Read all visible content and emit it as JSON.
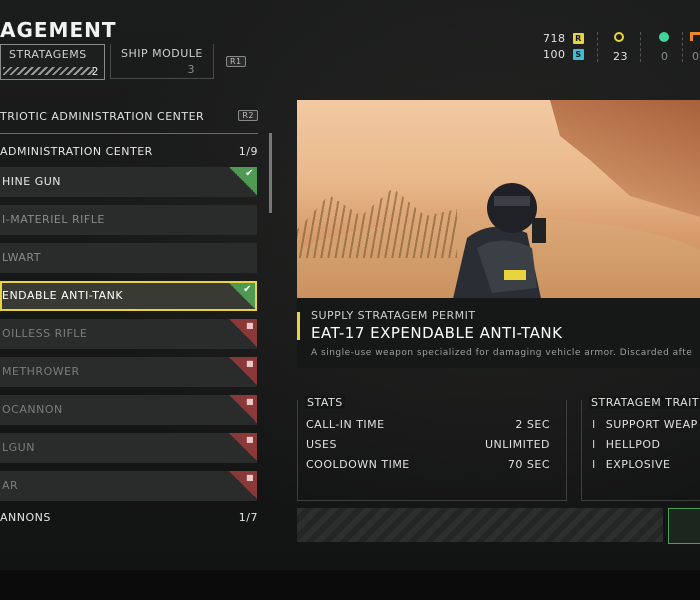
{
  "header": {
    "title": "AGEMENT",
    "tabs": [
      {
        "label": "STRATAGEMS",
        "count": "2"
      },
      {
        "label": "SHIP MODULE",
        "count": "3"
      }
    ],
    "next_button": "R1"
  },
  "currencies": [
    {
      "icon": "requisition-icon",
      "value": "718",
      "badge": "R",
      "color": "#e8d43c"
    },
    {
      "icon": "super-credits-icon",
      "value": "100",
      "badge": "S",
      "color": "#3fbfd4"
    },
    {
      "icon": "medals-icon",
      "value": "23",
      "color": "#e8d43c"
    },
    {
      "icon": "samples-green-icon",
      "value": "0",
      "color": "#3fd49a"
    },
    {
      "icon": "samples-orange-icon",
      "value": "0",
      "color": "#e88a2a"
    }
  ],
  "list": {
    "header": "TRIOTIC ADMINISTRATION CENTER",
    "header_button": "R2",
    "categories": [
      {
        "label": "ADMINISTRATION CENTER",
        "count": "1/9"
      },
      {
        "label": "ANNONS",
        "count": "1/7"
      }
    ],
    "items": [
      {
        "name": "HINE GUN",
        "status": "unlocked"
      },
      {
        "name": "I-MATERIEL RIFLE",
        "status": "none"
      },
      {
        "name": "LWART",
        "status": "none"
      },
      {
        "name": "ENDABLE ANTI-TANK",
        "status": "selected"
      },
      {
        "name": "OILLESS RIFLE",
        "status": "locked"
      },
      {
        "name": "METHROWER",
        "status": "locked"
      },
      {
        "name": "OCANNON",
        "status": "locked"
      },
      {
        "name": "LGUN",
        "status": "locked"
      },
      {
        "name": "AR",
        "status": "locked"
      }
    ]
  },
  "detail": {
    "subtitle": "SUPPLY STRATAGEM PERMIT",
    "title": "EAT-17 EXPENDABLE ANTI-TANK",
    "description": "A single-use weapon specialized for damaging vehicle armor. Discarded afte",
    "stats_label": "STATS",
    "stats": [
      {
        "label": "CALL-IN TIME",
        "value": "2 SEC"
      },
      {
        "label": "USES",
        "value": "UNLIMITED"
      },
      {
        "label": "COOLDOWN TIME",
        "value": "70 SEC"
      }
    ],
    "traits_label": "STRATAGEM TRAIT",
    "traits": [
      "SUPPORT WEAP",
      "HELLPOD",
      "EXPLOSIVE"
    ]
  },
  "colors": {
    "accent": "#e8d43c",
    "unlocked": "#4f9a52",
    "locked": "#8a3838"
  }
}
